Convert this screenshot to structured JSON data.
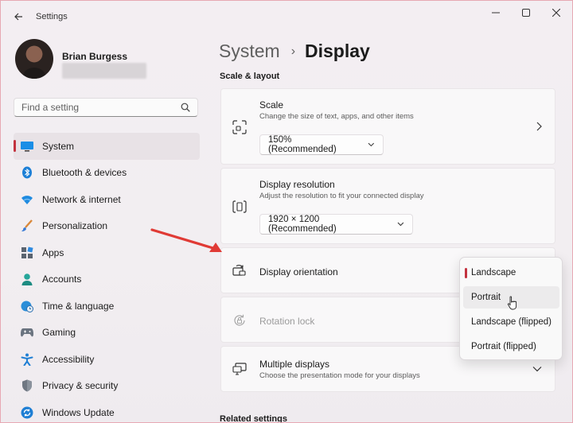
{
  "window": {
    "title": "Settings",
    "accent_color": "#c3333f"
  },
  "profile": {
    "name": "Brian Burgess"
  },
  "search": {
    "placeholder": "Find a setting"
  },
  "sidebar": {
    "items": [
      {
        "label": "System",
        "icon": "system-icon",
        "active": true
      },
      {
        "label": "Bluetooth & devices",
        "icon": "bluetooth-icon"
      },
      {
        "label": "Network & internet",
        "icon": "wifi-icon"
      },
      {
        "label": "Personalization",
        "icon": "brush-icon"
      },
      {
        "label": "Apps",
        "icon": "apps-icon"
      },
      {
        "label": "Accounts",
        "icon": "person-icon"
      },
      {
        "label": "Time & language",
        "icon": "globe-clock-icon"
      },
      {
        "label": "Gaming",
        "icon": "gamepad-icon"
      },
      {
        "label": "Accessibility",
        "icon": "accessibility-icon"
      },
      {
        "label": "Privacy & security",
        "icon": "shield-icon"
      },
      {
        "label": "Windows Update",
        "icon": "update-icon"
      }
    ]
  },
  "breadcrumb": {
    "parent": "System",
    "separator": "›",
    "current": "Display"
  },
  "main": {
    "section_title": "Scale & layout",
    "scale": {
      "title": "Scale",
      "description": "Change the size of text, apps, and other items",
      "value": "150% (Recommended)"
    },
    "resolution": {
      "title": "Display resolution",
      "description": "Adjust the resolution to fit your connected display",
      "value": "1920 × 1200 (Recommended)"
    },
    "orientation": {
      "title": "Display orientation"
    },
    "rotation_lock": {
      "title": "Rotation lock"
    },
    "multiple_displays": {
      "title": "Multiple displays",
      "description": "Choose the presentation mode for your displays"
    },
    "related_title": "Related settings"
  },
  "orientation_menu": {
    "options": [
      "Landscape",
      "Portrait",
      "Landscape (flipped)",
      "Portrait (flipped)"
    ],
    "selected": "Landscape",
    "hovered": "Portrait"
  }
}
